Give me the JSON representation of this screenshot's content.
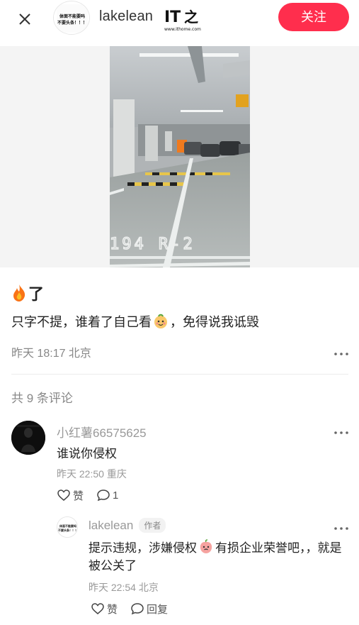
{
  "header": {
    "author_name": "lakelean",
    "avatar_text": "体面不能要吗？不要头条！！！",
    "logo_text": "IT之家",
    "logo_url_text": "www.ithome.com",
    "follow_label": "关注"
  },
  "post": {
    "title_icon": "fire-icon",
    "title_text": "了",
    "body_before": "只字不提，谁着了自己看",
    "body_emoji": "sticker-face-emoji",
    "body_after": "，免得说我诋毁",
    "meta": "昨天 18:17 北京",
    "image_overlay_text": "194  R-2"
  },
  "comments": {
    "count_label": "共 9 条评论",
    "items": [
      {
        "user": "小红薯66575625",
        "text": "谁说你侵权",
        "meta": "昨天 22:50 重庆",
        "like_label": "赞",
        "reply_count": "1",
        "reply": {
          "user": "lakelean",
          "author_tag": "作者",
          "text_before": "提示违规，涉嫌侵权",
          "text_emoji": "peach-face-emoji",
          "text_after": "有损企业荣誉吧，，就是被公关了",
          "meta": "昨天 22:54 北京",
          "like_label": "赞",
          "reply_label": "回复"
        }
      }
    ]
  },
  "colors": {
    "accent": "#ff2e4d",
    "muted": "#999999"
  }
}
